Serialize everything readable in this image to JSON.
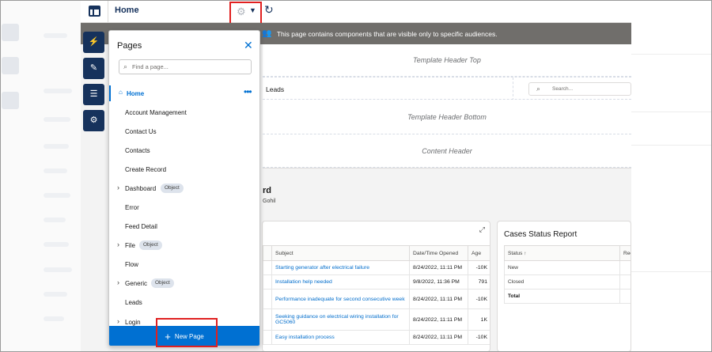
{
  "topbar": {
    "title": "Home"
  },
  "canvas": {
    "banner_text": "This page contains components that are visible only to specific audiences.",
    "template_header_top": "Template Header Top",
    "template_header_bottom": "Template Header Bottom",
    "content_header": "Content Header",
    "nav_leads": "Leads",
    "search_placeholder": "Search...",
    "record_title": "rd",
    "record_sub": "Gohil"
  },
  "cases_table": {
    "headers": [
      "Subject",
      "Date/Time Opened",
      "Age"
    ],
    "rows": [
      {
        "subject": "Starting generator after electrical failure",
        "date": "8/24/2022, 11:11 PM",
        "age": "-10K"
      },
      {
        "subject": "Installation help needed",
        "date": "9/8/2022, 11:36 PM",
        "age": "791"
      },
      {
        "subject": "Performance inadequate for second consecutive week",
        "date": "8/24/2022, 11:11 PM",
        "age": "-10K"
      },
      {
        "subject": "Seeking guidance on electrical wiring installation for GC5060",
        "date": "8/24/2022, 11:11 PM",
        "age": "1K"
      },
      {
        "subject": "Easy installation process",
        "date": "8/24/2022, 11:11 PM",
        "age": "-10K"
      }
    ]
  },
  "status_report": {
    "title": "Cases Status Report",
    "header_status": "Status ↑",
    "header_rec": "Rec",
    "rows": [
      "New",
      "Closed",
      "Total"
    ]
  },
  "pages_panel": {
    "title": "Pages",
    "find_placeholder": "Find a page...",
    "items": [
      {
        "label": "Home",
        "active": true
      },
      {
        "label": "Account Management"
      },
      {
        "label": "Contact Us"
      },
      {
        "label": "Contacts"
      },
      {
        "label": "Create Record"
      },
      {
        "label": "Dashboard",
        "expandable": true,
        "badge": "Object"
      },
      {
        "label": "Error"
      },
      {
        "label": "Feed Detail"
      },
      {
        "label": "File",
        "expandable": true,
        "badge": "Object"
      },
      {
        "label": "Flow"
      },
      {
        "label": "Generic",
        "expandable": true,
        "badge": "Object"
      },
      {
        "label": "Leads"
      },
      {
        "label": "Login",
        "expandable": true
      }
    ],
    "new_page_label": "New Page"
  },
  "colors": {
    "brand": "#0070d2",
    "navy": "#16325c",
    "highlight": "#e02020",
    "banner": "#706e6b"
  }
}
